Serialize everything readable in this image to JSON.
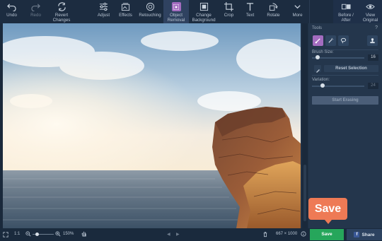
{
  "toolbar": {
    "undo": "Undo",
    "redo": "Redo",
    "revert_line1": "Revert",
    "revert_line2": "Changes",
    "adjust": "Adjust",
    "effects": "Effects",
    "retouching": "Retouching",
    "object_removal_line1": "Object",
    "object_removal_line2": "Removal",
    "change_bg_line1": "Change",
    "change_bg_line2": "Background",
    "crop": "Crop",
    "text": "Text",
    "rotate": "Rotate",
    "more": "More",
    "before_after_line1": "Before /",
    "before_after_line2": "After",
    "view_original_line1": "View",
    "view_original_line2": "Original"
  },
  "panel": {
    "tools_label": "Tools",
    "help": "?",
    "brush_size_label": "Brush Size:",
    "brush_size_value": "16",
    "reset_selection": "Reset Selection",
    "variation_label": "Variation:",
    "variation_value": "24",
    "start_erasing": "Start Erasing"
  },
  "statusbar": {
    "fit": "1:1",
    "zoom": "150%",
    "dimensions": "667 × 1000"
  },
  "actions": {
    "save": "Save",
    "share": "Share",
    "save_tooltip": "Save"
  },
  "colors": {
    "active_tool": "#a36cbf",
    "save": "#26a65b",
    "tooltip": "#ee7a55"
  }
}
